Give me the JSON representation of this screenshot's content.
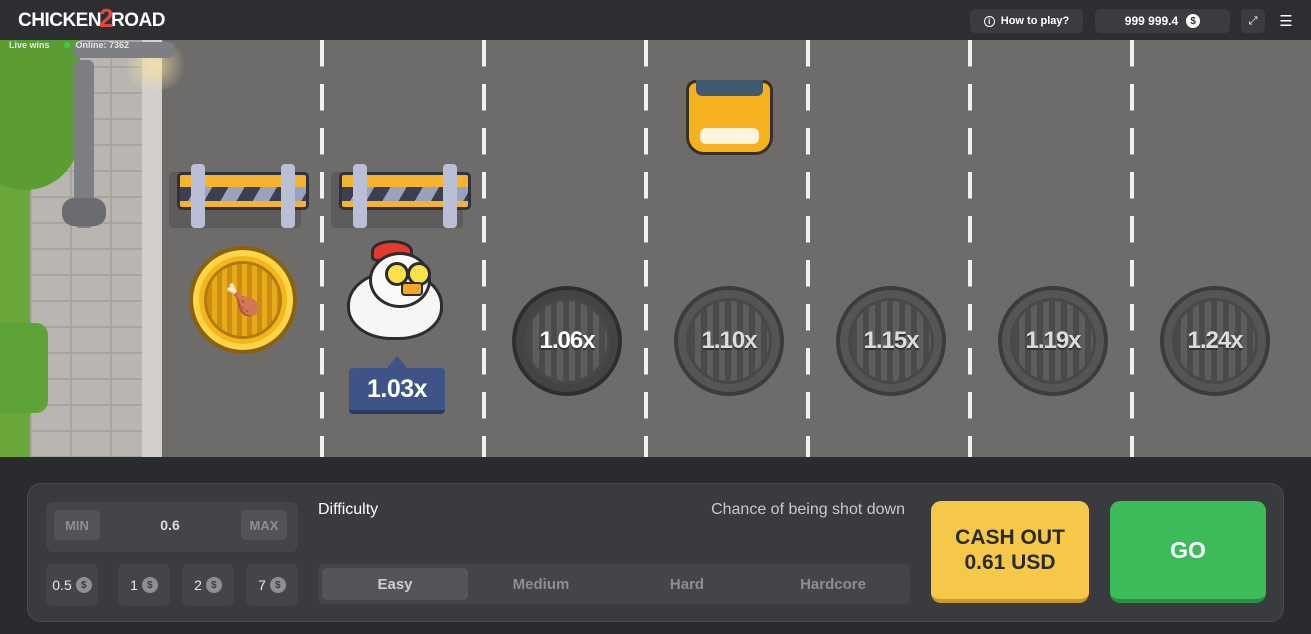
{
  "header": {
    "logo_left": "CHICKEN",
    "logo_num": "2",
    "logo_right": "ROAD",
    "how_to_play": "How to play?",
    "balance": "999 999.4",
    "currency_icon": "$"
  },
  "livebar": {
    "live_wins": "Live wins",
    "online": "Online: 7362"
  },
  "game": {
    "current_multiplier": "1.03x",
    "lanes": [
      {
        "multiplier": "1.06x",
        "state": "next"
      },
      {
        "multiplier": "1.10x",
        "state": "locked"
      },
      {
        "multiplier": "1.15x",
        "state": "locked"
      },
      {
        "multiplier": "1.19x",
        "state": "locked"
      },
      {
        "multiplier": "1.24x",
        "state": "locked"
      }
    ]
  },
  "controls": {
    "min_label": "MIN",
    "max_label": "MAX",
    "bet_value": "0.6",
    "quick_bets": [
      "0.5",
      "1",
      "2",
      "7"
    ],
    "difficulty_label": "Difficulty",
    "chance_label": "Chance of being shot down",
    "difficulties": [
      "Easy",
      "Medium",
      "Hard",
      "Hardcore"
    ],
    "selected_difficulty": "Easy",
    "cashout_line1": "CASH OUT",
    "cashout_line2": "0.61 USD",
    "go_label": "GO"
  },
  "colors": {
    "go": "#3bbb5a",
    "cashout": "#f6c84a",
    "road": "#6e6c6b",
    "tag": "#3e5488"
  }
}
